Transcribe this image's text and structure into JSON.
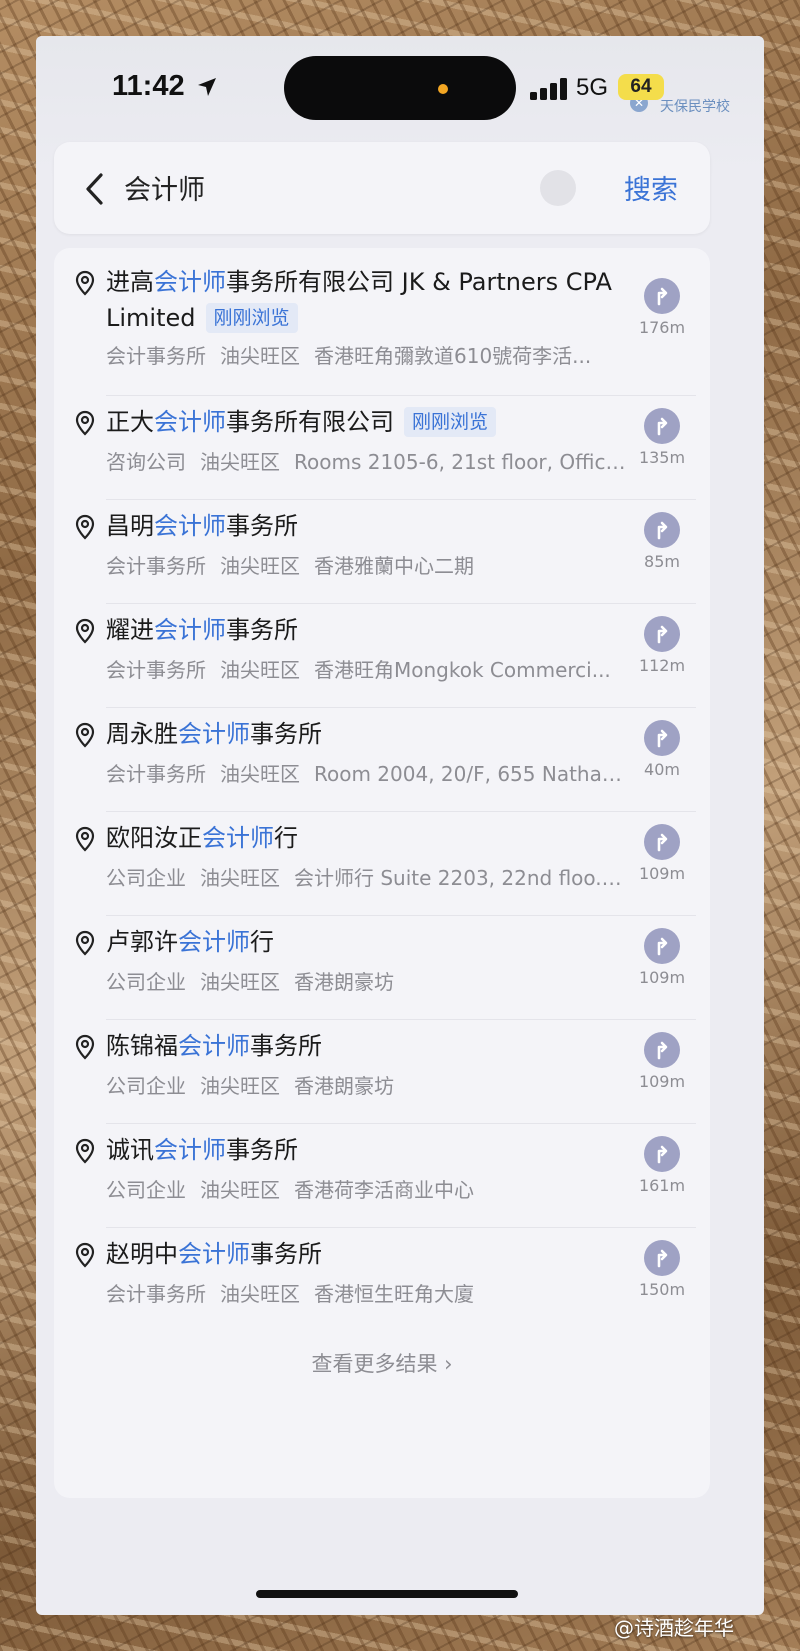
{
  "status_bar": {
    "time": "11:42",
    "network": "5G",
    "battery": "64",
    "map_label": "天保民学校"
  },
  "search": {
    "query": "会计师",
    "search_button": "搜索"
  },
  "results": [
    {
      "name_before": "进高",
      "name_highlight": "会计师",
      "name_after": "事务所有限公司 JK & Partners CPA Limited",
      "tag": "刚刚浏览",
      "category": "会计事务所",
      "district": "油尖旺区",
      "address": "香港旺角彌敦道610號荷李活...",
      "distance": "176m"
    },
    {
      "name_before": "正大",
      "name_highlight": "会计师",
      "name_after": "事务所有限公司",
      "tag": "刚刚浏览",
      "category": "咨询公司",
      "district": "油尖旺区",
      "address": "Rooms 2105-6, 21st floor, Offic...",
      "distance": "135m"
    },
    {
      "name_before": "昌明",
      "name_highlight": "会计师",
      "name_after": "事务所",
      "tag": "",
      "category": "会计事务所",
      "district": "油尖旺区",
      "address": "香港雅蘭中心二期",
      "distance": "85m"
    },
    {
      "name_before": "耀进",
      "name_highlight": "会计师",
      "name_after": "事务所",
      "tag": "",
      "category": "会计事务所",
      "district": "油尖旺区",
      "address": "香港旺角Mongkok Commerci...",
      "distance": "112m"
    },
    {
      "name_before": "周永胜",
      "name_highlight": "会计师",
      "name_after": "事务所",
      "tag": "",
      "category": "会计事务所",
      "district": "油尖旺区",
      "address": "Room 2004, 20/F, 655 Natha...",
      "distance": "40m"
    },
    {
      "name_before": "欧阳汝正",
      "name_highlight": "会计师",
      "name_after": "行",
      "tag": "",
      "category": "公司企业",
      "district": "油尖旺区",
      "address": "会计师行 Suite 2203, 22nd floo...",
      "distance": "109m"
    },
    {
      "name_before": "卢郭许",
      "name_highlight": "会计师",
      "name_after": "行",
      "tag": "",
      "category": "公司企业",
      "district": "油尖旺区",
      "address": "香港朗豪坊",
      "distance": "109m"
    },
    {
      "name_before": "陈锦福",
      "name_highlight": "会计师",
      "name_after": "事务所",
      "tag": "",
      "category": "公司企业",
      "district": "油尖旺区",
      "address": "香港朗豪坊",
      "distance": "109m"
    },
    {
      "name_before": "诚讯",
      "name_highlight": "会计师",
      "name_after": "事务所",
      "tag": "",
      "category": "公司企业",
      "district": "油尖旺区",
      "address": "香港荷李活商业中心",
      "distance": "161m"
    },
    {
      "name_before": "赵明中",
      "name_highlight": "会计师",
      "name_after": "事务所",
      "tag": "",
      "category": "会计事务所",
      "district": "油尖旺区",
      "address": "香港恒生旺角大廈",
      "distance": "150m"
    }
  ],
  "more_results": "查看更多结果 ›",
  "watermark": "@诗酒趁年华",
  "colors": {
    "accent": "#3a73d6",
    "nav_button": "#9fa2c4",
    "battery": "#f4dd4b"
  }
}
